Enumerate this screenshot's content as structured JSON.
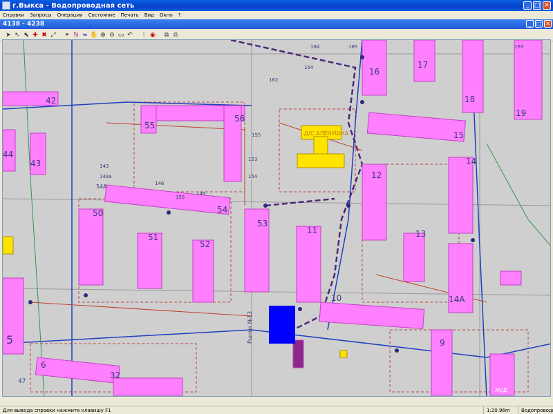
{
  "window": {
    "title": "г.Выкса - Водопроводная сеть",
    "buttons": [
      "_",
      "□",
      "✕"
    ]
  },
  "menu": [
    "Справки",
    "Запросы",
    "Операции",
    "Состояние",
    "Печать",
    "Вид",
    "Окно",
    "?"
  ],
  "mdi": {
    "title": "4138 - 4238",
    "buttons": [
      "_",
      "□",
      "✕"
    ]
  },
  "toolbar": {
    "coords": "4138 - 4238",
    "tools": [
      "pointer-icon",
      "select-icon",
      "select-region-icon",
      "add-node-icon",
      "delete-node-icon",
      "link-icon",
      "binoculars-icon",
      "query-icon",
      "wave-icon",
      "pan-hand-icon",
      "zoom-in-icon",
      "zoom-out-icon",
      "zoom-rect-icon",
      "undo-icon",
      "traffic-light-icon",
      "target-icon",
      "copy-icon",
      "print-icon"
    ]
  },
  "map": {
    "building_labels": [
      "42",
      "43",
      "44",
      "16",
      "17",
      "18",
      "19",
      "15",
      "55",
      "56",
      "163",
      "164",
      "14",
      "12",
      "13",
      "14А",
      "10",
      "11",
      "50",
      "51",
      "52",
      "53",
      "54",
      "54А",
      "9",
      "5",
      "6",
      "47",
      "32",
      "Д/С АЛЁНУШКА",
      "Ж/Д",
      "Рынок №13",
      "184",
      "185",
      "153",
      "154",
      "155",
      "162",
      "143",
      "149",
      "155",
      "146",
      "149а"
    ],
    "colors": {
      "building": "#ff80ff",
      "ground": "#cfcfcf",
      "pipe_main": "#4a2a7a",
      "pipe_blue": "#1f3fc0",
      "pipe_red": "#c0402a",
      "yellow_building": "#ffe400",
      "blue_block": "#0000ff"
    }
  },
  "status": {
    "hint": "Для вывода справки нажмите клавишу F1",
    "scale": "1:20.96m",
    "layer": "Водопроводная се"
  }
}
